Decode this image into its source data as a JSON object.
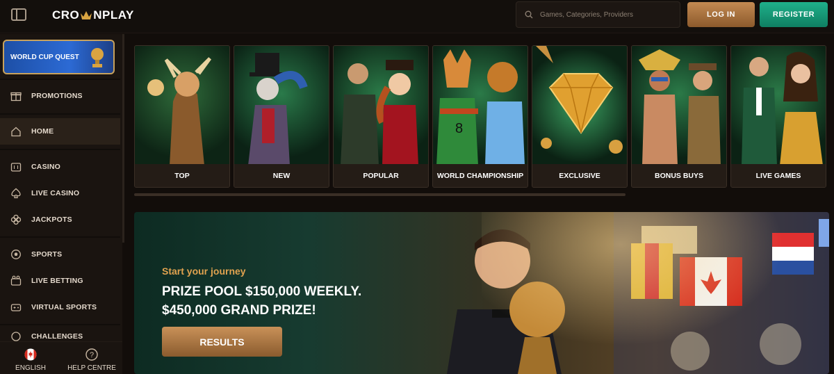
{
  "header": {
    "logo_left": "CRO",
    "logo_right": "NPLAY",
    "search_placeholder": "Games, Categories, Providers",
    "login_label": "LOG IN",
    "register_label": "REGISTER"
  },
  "sidebar": {
    "quest_label": "WORLD CUP QUEST",
    "items": [
      {
        "label": "PROMOTIONS",
        "icon": "gift-icon"
      },
      {
        "label": "HOME",
        "icon": "home-icon"
      },
      {
        "label": "CASINO",
        "icon": "slot-machine-icon"
      },
      {
        "label": "LIVE CASINO",
        "icon": "spade-icon"
      },
      {
        "label": "JACKPOTS",
        "icon": "clover-icon"
      },
      {
        "label": "SPORTS",
        "icon": "ball-icon"
      },
      {
        "label": "LIVE BETTING",
        "icon": "live-betting-icon"
      },
      {
        "label": "VIRTUAL SPORTS",
        "icon": "gamepad-icon"
      },
      {
        "label": "CHALLENGES",
        "icon": "challenges-icon"
      }
    ],
    "bottom": {
      "language_label": "ENGLISH",
      "help_label": "HELP CENTRE"
    }
  },
  "categories": [
    {
      "label": "TOP"
    },
    {
      "label": "NEW"
    },
    {
      "label": "POPULAR"
    },
    {
      "label": "WORLD CHAMPIONSHIP"
    },
    {
      "label": "EXCLUSIVE"
    },
    {
      "label": "BONUS BUYS"
    },
    {
      "label": "LIVE GAMES"
    }
  ],
  "banner": {
    "subtitle": "Start your journey",
    "title_line1": "PRIZE POOL $150,000 WEEKLY.",
    "title_line2": "$450,000 GRAND PRIZE!",
    "button_label": "RESULTS"
  },
  "colors": {
    "accent_gold": "#c38a52",
    "register_green": "#1fb08a",
    "background": "#120d0a",
    "quest_blue": "#2c6ad4"
  }
}
